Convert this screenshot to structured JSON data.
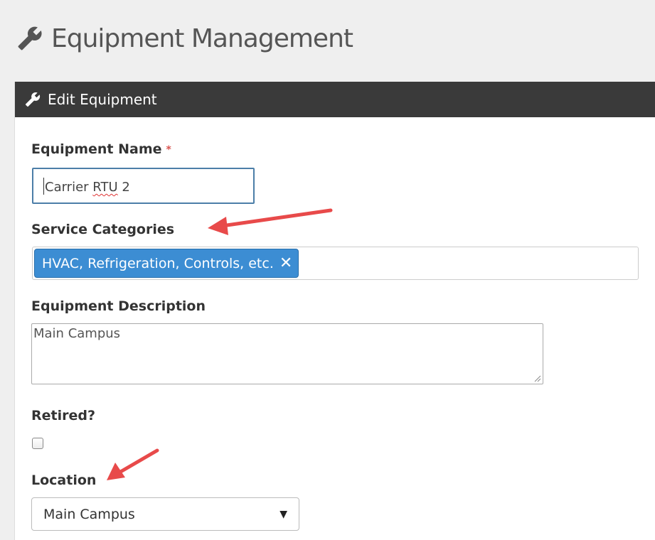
{
  "header": {
    "title": "Equipment Management",
    "icon": "wrench-icon"
  },
  "panel": {
    "title": "Edit Equipment",
    "icon": "wrench-icon"
  },
  "form": {
    "name": {
      "label": "Equipment Name",
      "required_marker": "*",
      "value_prefix": "Carrier ",
      "value_misspelled": "RTU",
      "value_suffix": " 2"
    },
    "categories": {
      "label": "Service Categories",
      "tags": [
        "HVAC, Refrigeration, Controls, etc."
      ],
      "remove_symbol": "✕"
    },
    "description": {
      "label": "Equipment Description",
      "value": "Main Campus"
    },
    "retired": {
      "label": "Retired?",
      "checked": false
    },
    "location": {
      "label": "Location",
      "selected": "Main Campus",
      "arrow": "▼"
    }
  },
  "colors": {
    "header_bar": "#3a3a3a",
    "tag": "#3c8dd3",
    "focus_border": "#4c7ea8",
    "annotation_arrow": "#e84a4a",
    "required": "#d9534f"
  }
}
